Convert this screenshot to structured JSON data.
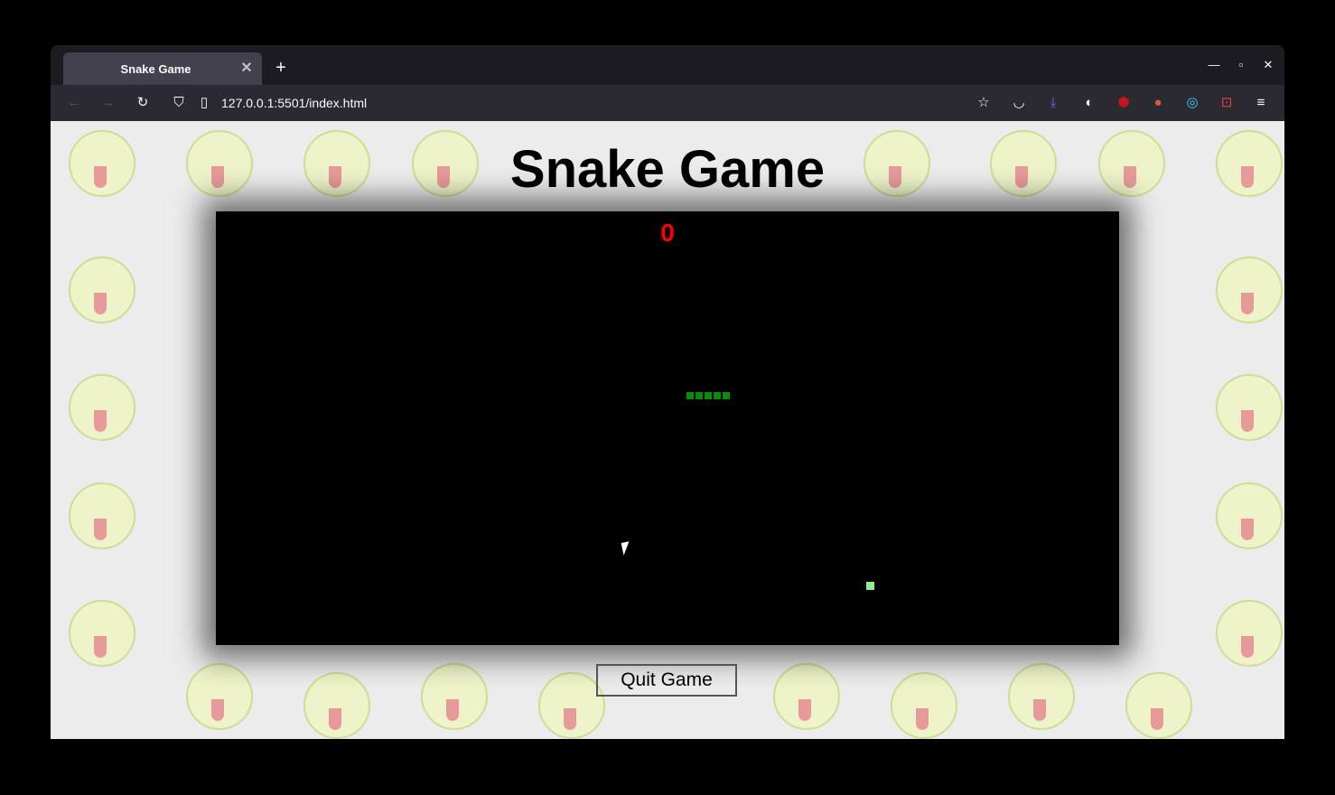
{
  "browser": {
    "tab_title": "Snake Game",
    "tab_close_icon": "close-icon",
    "new_tab_icon": "plus-icon",
    "url": "127.0.0.1:5501/index.html",
    "toolbar_icons": [
      "back-arrow-icon",
      "forward-arrow-icon",
      "reload-icon",
      "shield-icon",
      "page-icon",
      "bookmark-star-icon",
      "pocket-icon",
      "download-icon",
      "extension-icon",
      "ublock-icon",
      "duckduckgo-icon",
      "color-picker-icon",
      "screenshot-icon",
      "hamburger-menu-icon"
    ]
  },
  "page": {
    "title": "Snake Game",
    "score": "0",
    "quit_label": "Quit Game"
  },
  "game": {
    "snake_color": "#0b8a0b",
    "food_color": "#90ee90",
    "score_color": "#ff0000",
    "board_color": "#000000"
  }
}
